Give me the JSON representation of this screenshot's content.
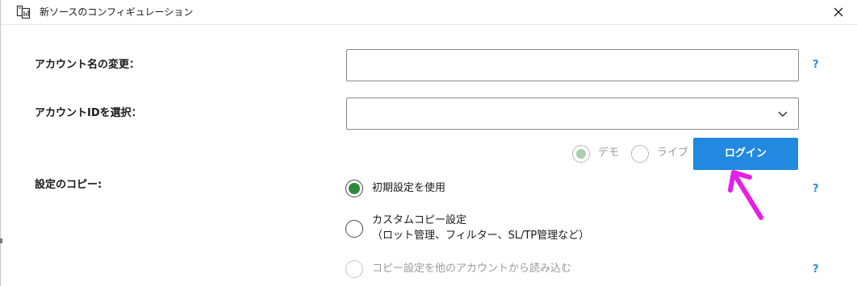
{
  "window": {
    "title": "新ソースのコンフィギュレーション",
    "icon": "app-config-icon",
    "close_icon": "close-icon"
  },
  "form": {
    "account_name_label": "アカウント名の変更：",
    "account_name_value": "",
    "account_id_label": "アカウントIDを選択：",
    "account_id_value": "",
    "help_symbol": "?",
    "server_type": {
      "options": [
        "デモ",
        "ライブ"
      ],
      "selected": "デモ",
      "disabled": true
    },
    "login_button": "ログイン",
    "copy_settings_label": "設定のコピー:",
    "copy_options": [
      {
        "label": "初期設定を使用",
        "selected": true,
        "disabled": false
      },
      {
        "label": "カスタムコピー設定",
        "sublabel": "（ロット管理、フィルター、SL/TP管理など）",
        "selected": false,
        "disabled": false
      },
      {
        "label": "コピー設定を他のアカウントから読み込む",
        "selected": false,
        "disabled": true
      }
    ]
  },
  "colors": {
    "accent": "#2288e0",
    "help": "#2b8ad8",
    "radio_selected": "#2e8b3a",
    "radio_disabled_selected": "#a9cfa9",
    "annotation_arrow": "#e61ee6"
  },
  "annotation": {
    "arrow_icon": "pointer-arrow-icon",
    "target": "login-button"
  }
}
